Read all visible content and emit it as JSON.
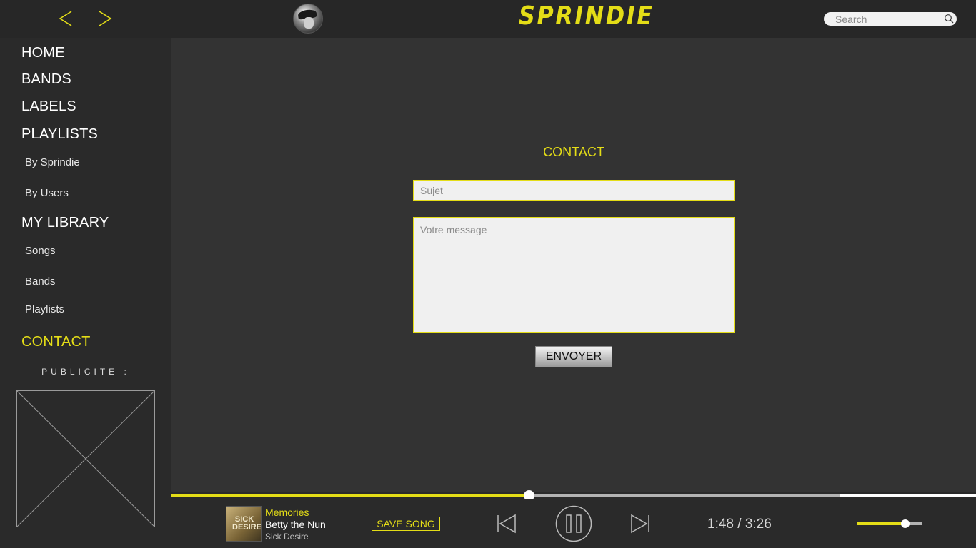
{
  "app": {
    "logo": "SPRINDIE"
  },
  "header": {
    "search_placeholder": "Search"
  },
  "sidebar": {
    "home": "HOME",
    "bands": "BANDS",
    "labels": "LABELS",
    "playlists": "PLAYLISTS",
    "by_sprindie": "By Sprindie",
    "by_users": "By Users",
    "my_library": "MY LIBRARY",
    "songs": "Songs",
    "lib_bands": "Bands",
    "lib_playlists": "Playlists",
    "contact": "CONTACT",
    "pub_label": "PUBLICITE :"
  },
  "contact_form": {
    "title": "CONTACT",
    "subject_placeholder": "Sujet",
    "message_placeholder": "Votre message",
    "send_label": "ENVOYER"
  },
  "player": {
    "cover_text": "SICK DESIRE",
    "song_title": "Memories",
    "artist": "Betty the Nun",
    "album": "Sick Desire",
    "save_label": "SAVE SONG",
    "current_time": "1:48",
    "total_time": "3:26",
    "time_display": "1:48 / 3:26",
    "progress_played_fraction": 0.444,
    "progress_buffered_fraction": 0.83,
    "volume_fraction": 0.74
  },
  "colors": {
    "accent": "#e4dd17",
    "background": "#2a2a2a",
    "content_background": "#333333"
  },
  "icons": {
    "back": "chevron-left-icon",
    "forward": "chevron-right-icon",
    "search": "search-icon",
    "previous": "skip-previous-icon",
    "pause": "pause-icon",
    "next": "skip-next-icon"
  }
}
